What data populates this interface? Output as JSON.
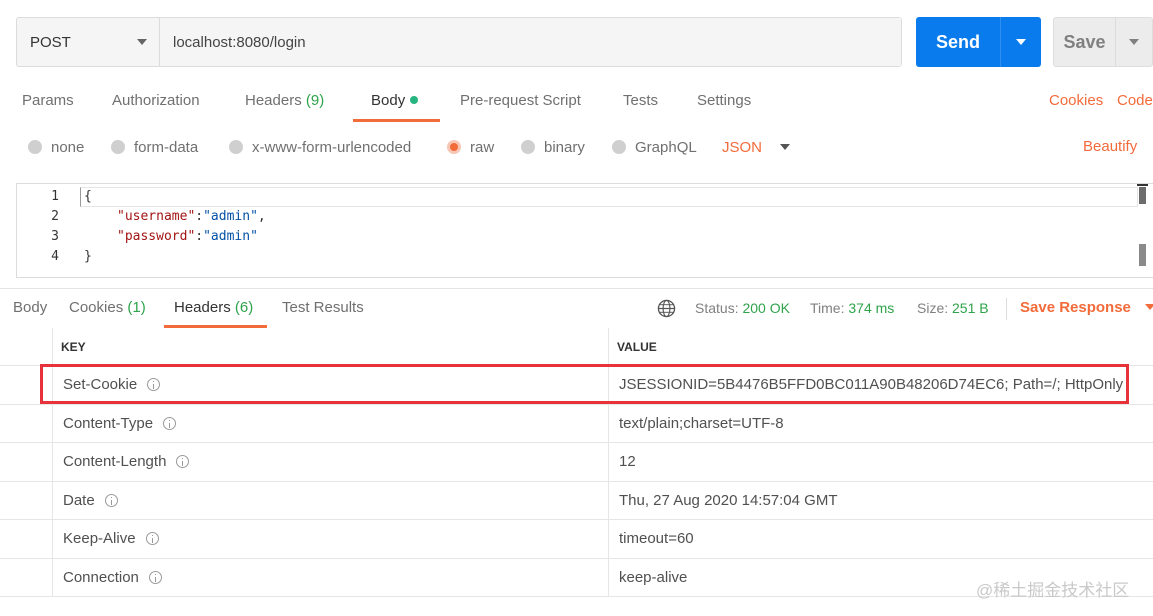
{
  "request": {
    "method": "POST",
    "url": "localhost:8080/login",
    "send_label": "Send",
    "save_label": "Save"
  },
  "request_tabs": {
    "params": "Params",
    "authorization": "Authorization",
    "headers_label": "Headers",
    "headers_count": "(9)",
    "body": "Body",
    "pre_request": "Pre-request Script",
    "tests": "Tests",
    "settings": "Settings",
    "cookies": "Cookies",
    "code": "Code"
  },
  "body_types": {
    "none": "none",
    "form_data": "form-data",
    "urlencoded": "x-www-form-urlencoded",
    "raw": "raw",
    "binary": "binary",
    "graphql": "GraphQL",
    "language": "JSON",
    "beautify": "Beautify"
  },
  "editor": {
    "lines": [
      {
        "n": "1",
        "text": "{"
      },
      {
        "n": "2",
        "key": "\"username\"",
        "sep": ":",
        "val": "\"admin\"",
        "end": ","
      },
      {
        "n": "3",
        "key": "\"password\"",
        "sep": ":",
        "val": "\"admin\"",
        "end": ""
      },
      {
        "n": "4",
        "text": "}"
      }
    ]
  },
  "response_tabs": {
    "body": "Body",
    "cookies_label": "Cookies",
    "cookies_count": "(1)",
    "headers_label": "Headers",
    "headers_count": "(6)",
    "test_results": "Test Results",
    "status_label": "Status:",
    "status_value": "200 OK",
    "time_label": "Time:",
    "time_value": "374 ms",
    "size_label": "Size:",
    "size_value": "251 B",
    "save_response": "Save Response"
  },
  "headers_table": {
    "key_header": "KEY",
    "value_header": "VALUE",
    "rows": [
      {
        "key": "Set-Cookie",
        "value": "JSESSIONID=5B4476B5FFD0BC011A90B48206D74EC6; Path=/; HttpOnly"
      },
      {
        "key": "Content-Type",
        "value": "text/plain;charset=UTF-8"
      },
      {
        "key": "Content-Length",
        "value": "12"
      },
      {
        "key": "Date",
        "value": "Thu, 27 Aug 2020 14:57:04 GMT"
      },
      {
        "key": "Keep-Alive",
        "value": "timeout=60"
      },
      {
        "key": "Connection",
        "value": "keep-alive"
      }
    ]
  },
  "watermark": "@稀土掘金技术社区",
  "colors": {
    "accent_orange": "#f26b3a",
    "send_blue": "#097bed",
    "success_green": "#2fa34c",
    "highlight_red": "#e8323a"
  }
}
